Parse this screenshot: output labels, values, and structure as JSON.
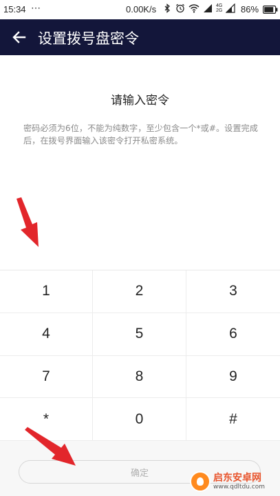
{
  "status_bar": {
    "time": "15:34",
    "more": "⋯",
    "net_speed": "0.00K/s",
    "signal_label_top": "4G",
    "signal_label_bottom": "2G",
    "battery": "86%",
    "icons": [
      "bluetooth-icon",
      "alarm-icon",
      "wifi-icon",
      "cell-signal-icon",
      "cell-signal-icon",
      "battery-icon"
    ]
  },
  "app_bar": {
    "title": "设置拨号盘密令",
    "background": "#13163a"
  },
  "prompt": {
    "title": "请输入密令",
    "description": "密码必须为6位，不能为纯数字，至少包含一个*或#。设置完成后，在拨号界面输入该密令打开私密系统。"
  },
  "keypad": {
    "keys": [
      "1",
      "2",
      "3",
      "4",
      "5",
      "6",
      "7",
      "8",
      "9",
      "*",
      "0",
      "#"
    ]
  },
  "confirm": {
    "label": "确定"
  },
  "watermark": {
    "name": "启东安卓网",
    "url": "www.qdltdu.com"
  },
  "annotation_color": "#e2262b"
}
